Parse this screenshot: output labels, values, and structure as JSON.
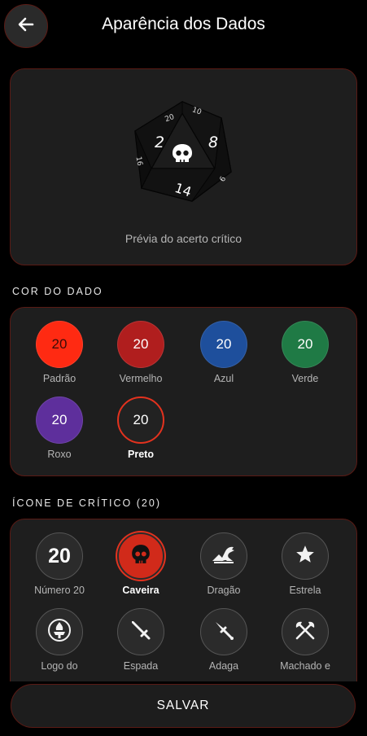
{
  "header": {
    "title": "Aparência dos Dados",
    "back_icon": "arrow-left-icon"
  },
  "preview": {
    "caption": "Prévia do acerto crítico",
    "die_faces": [
      "2",
      "8",
      "14",
      "20",
      "10",
      "16",
      "6"
    ],
    "crit_icon": "skull-icon"
  },
  "dice_color": {
    "section_label": "COR DO DADO",
    "options": [
      {
        "label": "Padrão",
        "value": "20",
        "color": "#ff2a12",
        "text_color": "#3a0c08"
      },
      {
        "label": "Vermelho",
        "value": "20",
        "color": "#b01e1e",
        "text_color": "#ffffff"
      },
      {
        "label": "Azul",
        "value": "20",
        "color": "#1e4f9c",
        "text_color": "#ffffff"
      },
      {
        "label": "Verde",
        "value": "20",
        "color": "#1f7a45",
        "text_color": "#ffffff"
      },
      {
        "label": "Roxo",
        "value": "20",
        "color": "#5e2f9c",
        "text_color": "#ffffff"
      },
      {
        "label": "Preto",
        "value": "20",
        "color": "#222222",
        "text_color": "#ffffff",
        "selected": true
      }
    ]
  },
  "crit_icon": {
    "section_label": "ÍCONE DE CRÍTICO (20)",
    "options": [
      {
        "label": "Número 20",
        "icon": "number-20",
        "value": "20"
      },
      {
        "label": "Caveira",
        "icon": "skull-icon",
        "selected": true
      },
      {
        "label": "Dragão",
        "icon": "dragon-icon"
      },
      {
        "label": "Estrela",
        "icon": "star-icon"
      },
      {
        "label": "Logo do",
        "icon": "logo-icon"
      },
      {
        "label": "Espada",
        "icon": "sword-icon"
      },
      {
        "label": "Adaga",
        "icon": "dagger-icon"
      },
      {
        "label": "Machado e",
        "icon": "axe-icon"
      }
    ]
  },
  "actions": {
    "save_label": "SALVAR"
  },
  "colors": {
    "accent": "#e3321e",
    "border": "#5a1a14",
    "card": "#1e1e1e",
    "background": "#000000"
  }
}
